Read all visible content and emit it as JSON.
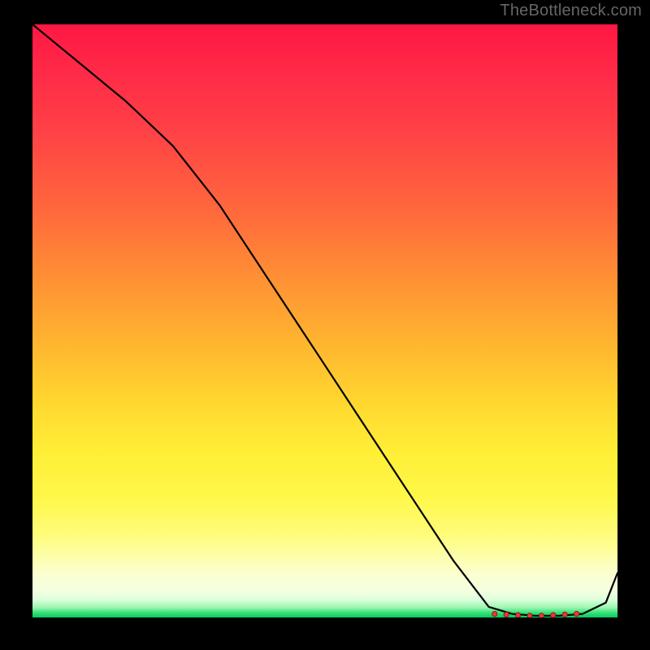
{
  "watermark": "TheBottleneck.com",
  "chart_data": {
    "type": "line",
    "x": [
      0.0,
      0.08,
      0.16,
      0.24,
      0.32,
      0.4,
      0.48,
      0.56,
      0.64,
      0.72,
      0.78,
      0.82,
      0.86,
      0.9,
      0.94,
      0.98,
      1.0
    ],
    "y": [
      1.0,
      0.935,
      0.87,
      0.795,
      0.695,
      0.575,
      0.455,
      0.335,
      0.215,
      0.095,
      0.018,
      0.006,
      0.003,
      0.003,
      0.006,
      0.025,
      0.075
    ],
    "markers": {
      "x": [
        0.79,
        0.81,
        0.83,
        0.85,
        0.87,
        0.89,
        0.91,
        0.93
      ],
      "y": [
        0.006,
        0.005,
        0.004,
        0.003,
        0.003,
        0.004,
        0.005,
        0.006
      ]
    },
    "title": "",
    "xlabel": "",
    "ylabel": "",
    "xlim": [
      0,
      1
    ],
    "ylim": [
      0,
      1
    ],
    "background_gradient": {
      "orientation": "vertical",
      "stops": [
        {
          "pos": 0.0,
          "color": "#ff1744"
        },
        {
          "pos": 0.3,
          "color": "#ff6a3c"
        },
        {
          "pos": 0.55,
          "color": "#ffb92f"
        },
        {
          "pos": 0.75,
          "color": "#ffee36"
        },
        {
          "pos": 0.9,
          "color": "#fdffae"
        },
        {
          "pos": 0.97,
          "color": "#dcffdc"
        },
        {
          "pos": 1.0,
          "color": "#08c95d"
        }
      ]
    }
  }
}
